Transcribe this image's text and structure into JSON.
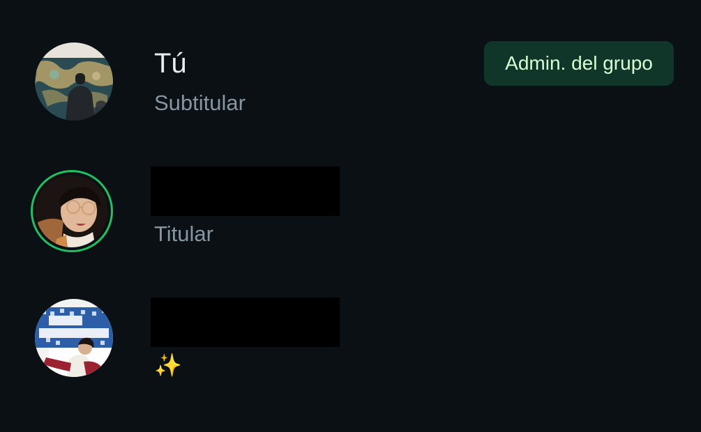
{
  "members": [
    {
      "name": "Tú",
      "subtitle": "Subtitular",
      "badge": "Admin. del grupo",
      "avatar_icon": "avatar-world-map-photo"
    },
    {
      "name": "",
      "name_redacted": true,
      "subtitle": "Titular",
      "has_status_ring": true,
      "avatar_icon": "avatar-portrait-photo"
    },
    {
      "name": "",
      "name_redacted": true,
      "subtitle": "✨",
      "avatar_icon": "avatar-birthday-photo"
    }
  ],
  "colors": {
    "background": "#0b1014",
    "primary_text": "#e9edef",
    "secondary_text": "#8696a0",
    "status_ring": "#21c063",
    "badge_background": "#103529",
    "badge_text": "#d9fdd3"
  }
}
